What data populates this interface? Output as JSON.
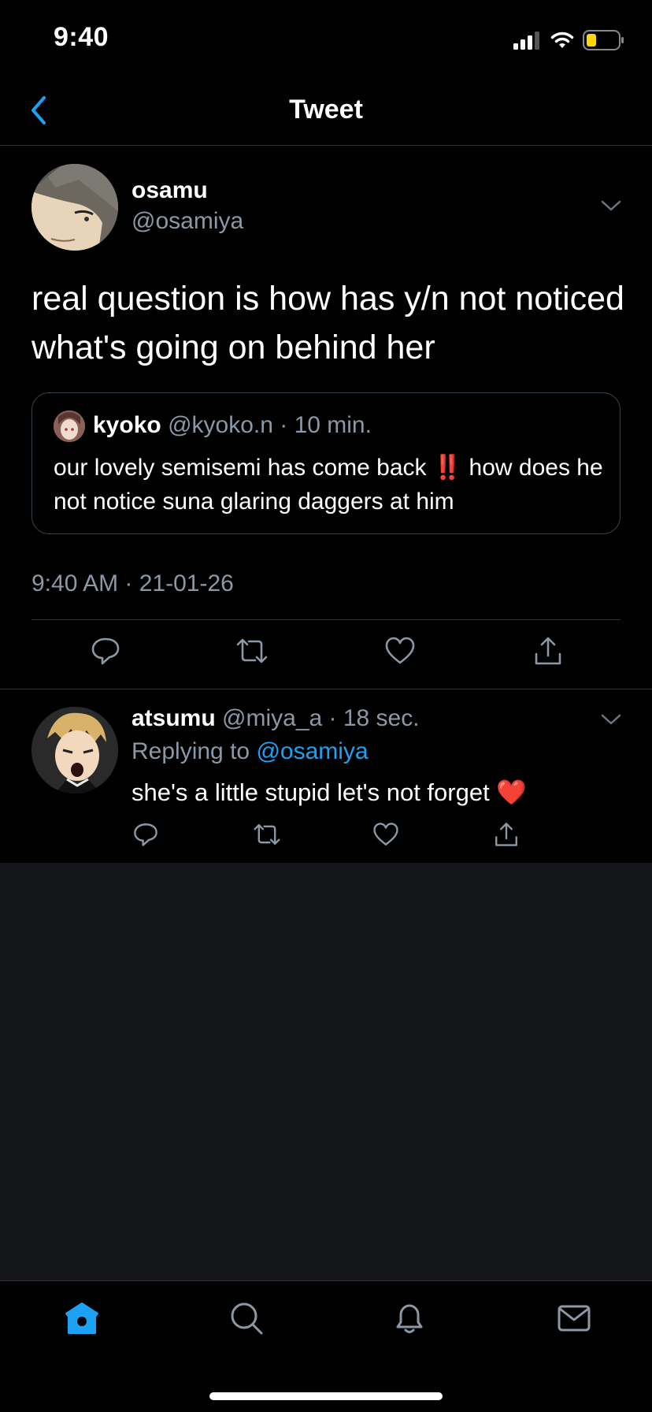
{
  "status_bar": {
    "time": "9:40"
  },
  "nav": {
    "title": "Tweet"
  },
  "main_tweet": {
    "name": "osamu",
    "handle": "@osamiya",
    "text": "real question is how has y/n not noticed what's going on behind her",
    "quoted": {
      "name": "kyoko",
      "meta": "@kyoko.n · 10 min.",
      "text_before": "our lovely semisemi has come back ",
      "emoji": "‼️",
      "text_after": " how does he not notice suna glaring daggers at him"
    },
    "timestamp": "9:40 AM · 21-01-26"
  },
  "reply_tweet": {
    "name": "atsumu",
    "meta": "@miya_a · 18 sec.",
    "replying_prefix": "Replying to ",
    "replying_to": "@osamiya",
    "text": "she's a little stupid let's not forget ",
    "emoji": "❤️"
  },
  "colors": {
    "accent": "#1da1f2",
    "secondary_text": "#8b98a5",
    "background": "#000000",
    "divider": "#2f3336",
    "battery_low": "#ffd60a"
  },
  "icons": {
    "status": [
      "signal-icon",
      "wifi-icon",
      "battery-icon"
    ],
    "actions": [
      "reply-icon",
      "retweet-icon",
      "like-icon",
      "share-icon"
    ],
    "tabs": [
      "home-icon",
      "search-icon",
      "bell-icon",
      "mail-icon"
    ]
  }
}
